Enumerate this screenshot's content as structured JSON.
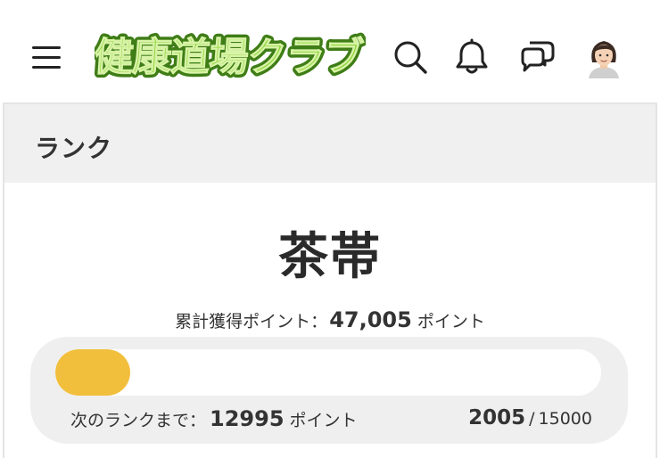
{
  "header": {
    "logo_text": "健康道場クラブ",
    "icons": [
      "menu-icon",
      "search-icon",
      "bell-icon",
      "chat-icon",
      "avatar"
    ]
  },
  "rank_card": {
    "title": "ランク",
    "rank_name": "茶帯",
    "total_points_label": "累計獲得ポイント：",
    "total_points_value": "47,005",
    "points_unit": "ポイント",
    "next_rank_label": "次のランクまで：",
    "next_rank_value": "12995",
    "current_progress": "2005",
    "separator": "/",
    "progress_goal": "15000",
    "progress_fraction": 0.1337
  },
  "colors": {
    "logo_green": "#7bc62d",
    "logo_outline": "#3f7d17",
    "progress_fill": "#f2bf3d",
    "card_header_bg": "#f0f0f0",
    "progress_panel_bg": "#efefef"
  }
}
